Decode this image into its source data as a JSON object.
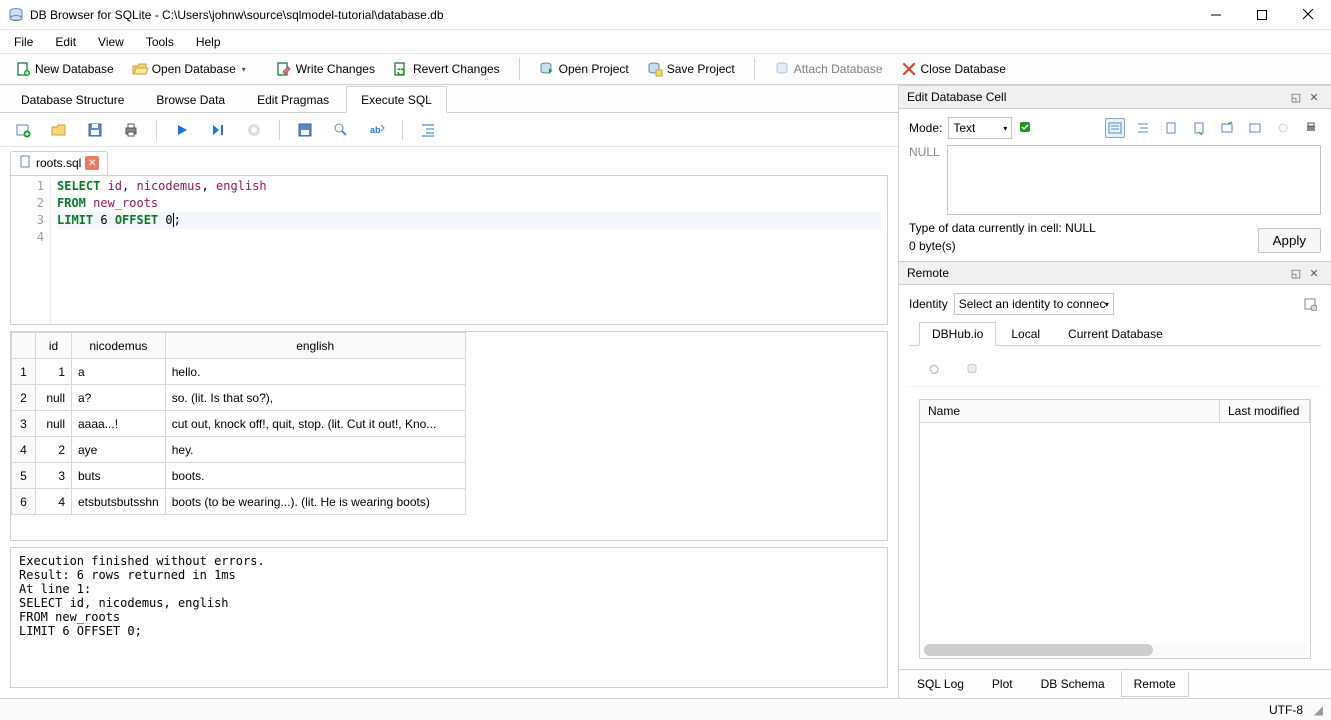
{
  "title": "DB Browser for SQLite - C:\\Users\\johnw\\source\\sqlmodel-tutorial\\database.db",
  "menu": [
    "File",
    "Edit",
    "View",
    "Tools",
    "Help"
  ],
  "toolbar": {
    "new_db": "New Database",
    "open_db": "Open Database",
    "write_changes": "Write Changes",
    "revert_changes": "Revert Changes",
    "open_project": "Open Project",
    "save_project": "Save Project",
    "attach_db": "Attach Database",
    "close_db": "Close Database"
  },
  "main_tabs": [
    "Database Structure",
    "Browse Data",
    "Edit Pragmas",
    "Execute SQL"
  ],
  "main_tab_active": 3,
  "file_tab": "roots.sql",
  "sql_lines": [
    {
      "n": "1",
      "tokens": [
        [
          "kw",
          "SELECT"
        ],
        [
          "",
          ""
        ],
        [
          "ident",
          " id"
        ],
        [
          "",
          ","
        ],
        [
          "ident",
          " nicodemus"
        ],
        [
          "",
          ","
        ],
        [
          "ident",
          " english"
        ]
      ]
    },
    {
      "n": "2",
      "tokens": [
        [
          "kw",
          "FROM"
        ],
        [
          "ident",
          " new_roots"
        ]
      ]
    },
    {
      "n": "3",
      "tokens": [
        [
          "kw",
          "LIMIT"
        ],
        [
          "",
          " 6 "
        ],
        [
          "kw",
          "OFFSET"
        ],
        [
          "",
          " 0"
        ],
        [
          "cursor",
          ""
        ],
        [
          "",
          ";"
        ]
      ],
      "hl": true
    },
    {
      "n": "4",
      "tokens": [
        [
          "",
          ""
        ]
      ]
    }
  ],
  "result_cols": [
    "id",
    "nicodemus",
    "english"
  ],
  "result_rows": [
    [
      "1",
      "1",
      "a",
      "hello."
    ],
    [
      "2",
      "null",
      "a?",
      "so. (lit. Is that so?),"
    ],
    [
      "3",
      "null",
      "aaaa...!",
      "cut out, knock off!, quit, stop. (lit. Cut it out!, Kno..."
    ],
    [
      "4",
      "2",
      "aye",
      "hey."
    ],
    [
      "5",
      "3",
      "buts",
      "boots."
    ],
    [
      "6",
      "4",
      "etsbutsbutsshn",
      "boots (to be wearing...). (lit. He is wearing boots)"
    ]
  ],
  "log_text": "Execution finished without errors.\nResult: 6 rows returned in 1ms\nAt line 1:\nSELECT id, nicodemus, english\nFROM new_roots\nLIMIT 6 OFFSET 0;",
  "edit_panel": {
    "title": "Edit Database Cell",
    "mode_label": "Mode:",
    "mode_value": "Text",
    "null": "NULL",
    "type_info": "Type of data currently in cell: NULL",
    "bytes": "0 byte(s)",
    "apply": "Apply"
  },
  "remote_panel": {
    "title": "Remote",
    "identity_label": "Identity",
    "identity_value": "Select an identity to connect",
    "tabs": [
      "DBHub.io",
      "Local",
      "Current Database"
    ],
    "active_tab": 0,
    "col_name": "Name",
    "col_mod": "Last modified"
  },
  "bottom_tabs": [
    "SQL Log",
    "Plot",
    "DB Schema",
    "Remote"
  ],
  "bottom_active": 3,
  "status_encoding": "UTF-8"
}
